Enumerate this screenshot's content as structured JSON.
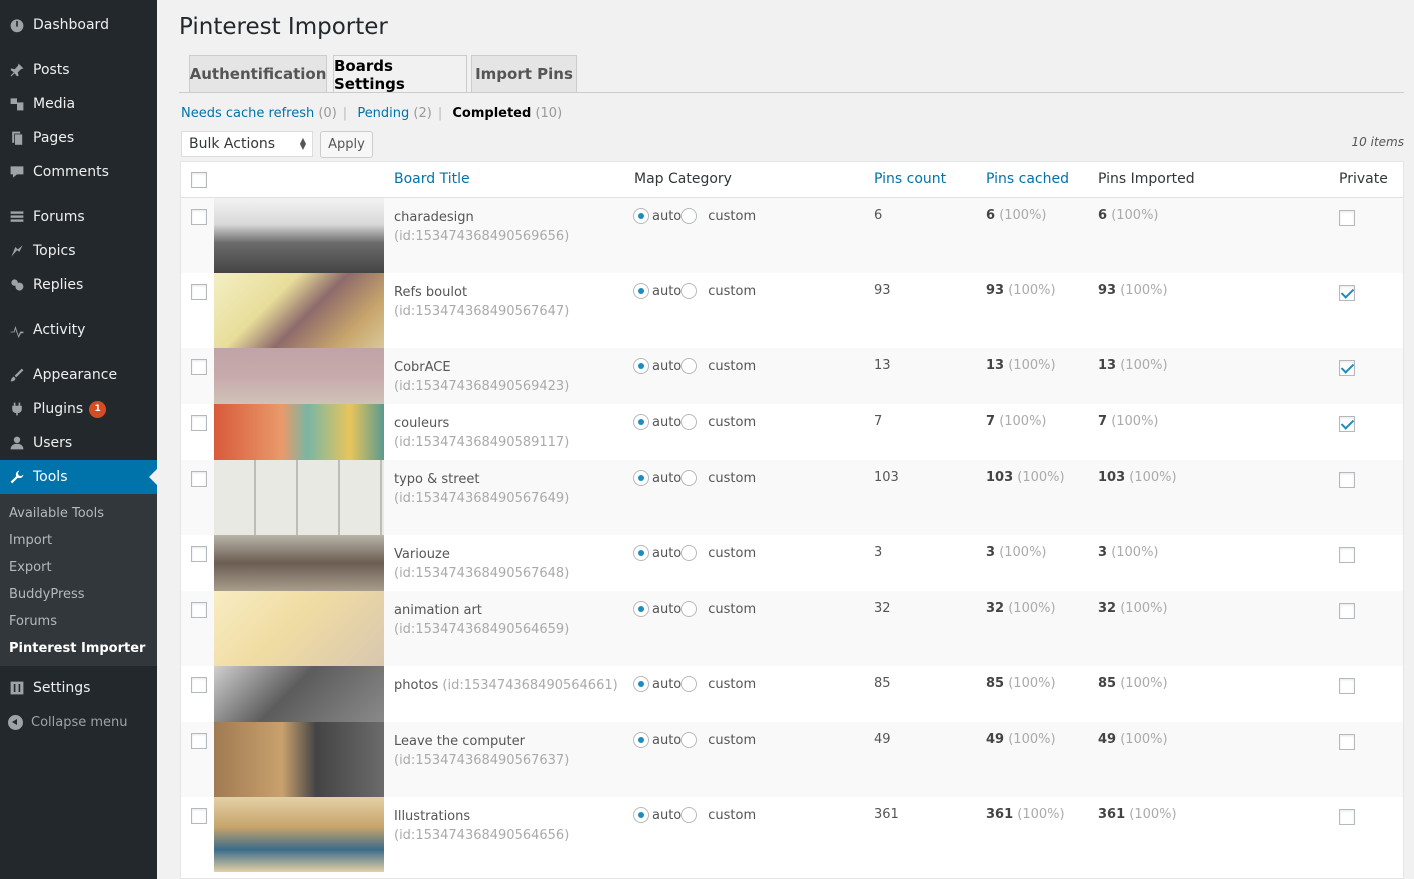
{
  "sidebar": {
    "items": [
      {
        "label": "Dashboard",
        "icon": "dashboard-icon"
      },
      {
        "label": "Posts",
        "icon": "pin-icon"
      },
      {
        "label": "Media",
        "icon": "media-icon"
      },
      {
        "label": "Pages",
        "icon": "pages-icon"
      },
      {
        "label": "Comments",
        "icon": "comment-icon"
      },
      {
        "label": "Forums",
        "icon": "forums-icon"
      },
      {
        "label": "Topics",
        "icon": "topics-icon"
      },
      {
        "label": "Replies",
        "icon": "replies-icon"
      },
      {
        "label": "Activity",
        "icon": "activity-icon"
      },
      {
        "label": "Appearance",
        "icon": "brush-icon"
      },
      {
        "label": "Plugins",
        "icon": "plugin-icon",
        "badge": "1"
      },
      {
        "label": "Users",
        "icon": "user-icon"
      },
      {
        "label": "Tools",
        "icon": "wrench-icon"
      }
    ],
    "submenu": [
      "Available Tools",
      "Import",
      "Export",
      "BuddyPress",
      "Forums",
      "Pinterest Importer"
    ],
    "settings": "Settings",
    "collapse": "Collapse menu"
  },
  "page": {
    "title": "Pinterest Importer",
    "tabs": [
      "Authentification",
      "Boards Settings",
      "Import Pins"
    ]
  },
  "filters": {
    "needs_cache": "Needs cache refresh",
    "needs_cache_count": "(0)",
    "pending": "Pending",
    "pending_count": "(2)",
    "completed": "Completed",
    "completed_count": "(10)"
  },
  "toolbar": {
    "bulk_actions": "Bulk Actions",
    "apply": "Apply",
    "items_count": "10 items"
  },
  "table": {
    "headers": {
      "board_title": "Board Title",
      "map_category": "Map Category",
      "pins_count": "Pins count",
      "pins_cached": "Pins cached",
      "pins_imported": "Pins Imported",
      "private": "Private"
    },
    "radio_auto": "auto",
    "radio_custom": "custom",
    "rows": [
      {
        "title": "charadesign",
        "id": "(id:153474368490569656)",
        "count": "6",
        "cached": "6",
        "cached_pct": "(100%)",
        "imported": "6",
        "imported_pct": "(100%)",
        "private": false
      },
      {
        "title": "Refs boulot",
        "id": "(id:153474368490567647)",
        "count": "93",
        "cached": "93",
        "cached_pct": "(100%)",
        "imported": "93",
        "imported_pct": "(100%)",
        "private": true
      },
      {
        "title": "CobrACE",
        "id": "(id:153474368490569423)",
        "count": "13",
        "cached": "13",
        "cached_pct": "(100%)",
        "imported": "13",
        "imported_pct": "(100%)",
        "private": true
      },
      {
        "title": "couleurs",
        "id": "(id:153474368490589117)",
        "count": "7",
        "cached": "7",
        "cached_pct": "(100%)",
        "imported": "7",
        "imported_pct": "(100%)",
        "private": true
      },
      {
        "title": "typo & street",
        "id": "(id:153474368490567649)",
        "count": "103",
        "cached": "103",
        "cached_pct": "(100%)",
        "imported": "103",
        "imported_pct": "(100%)",
        "private": false
      },
      {
        "title": "Variouze",
        "id": "(id:153474368490567648)",
        "count": "3",
        "cached": "3",
        "cached_pct": "(100%)",
        "imported": "3",
        "imported_pct": "(100%)",
        "private": false
      },
      {
        "title": "animation art",
        "id": "(id:153474368490564659)",
        "count": "32",
        "cached": "32",
        "cached_pct": "(100%)",
        "imported": "32",
        "imported_pct": "(100%)",
        "private": false
      },
      {
        "title": "photos",
        "id": "(id:153474368490564661)",
        "count": "85",
        "cached": "85",
        "cached_pct": "(100%)",
        "imported": "85",
        "imported_pct": "(100%)",
        "private": false
      },
      {
        "title": "Leave the computer",
        "id": "(id:153474368490567637)",
        "count": "49",
        "cached": "49",
        "cached_pct": "(100%)",
        "imported": "49",
        "imported_pct": "(100%)",
        "private": false
      },
      {
        "title": "Illustrations",
        "id": "(id:153474368490564656)",
        "count": "361",
        "cached": "361",
        "cached_pct": "(100%)",
        "imported": "361",
        "imported_pct": "(100%)",
        "private": false
      }
    ]
  },
  "colors": {
    "sidebar_bg": "#23282d",
    "submenu_bg": "#32373c",
    "accent": "#0073aa",
    "badge": "#d54e21"
  }
}
